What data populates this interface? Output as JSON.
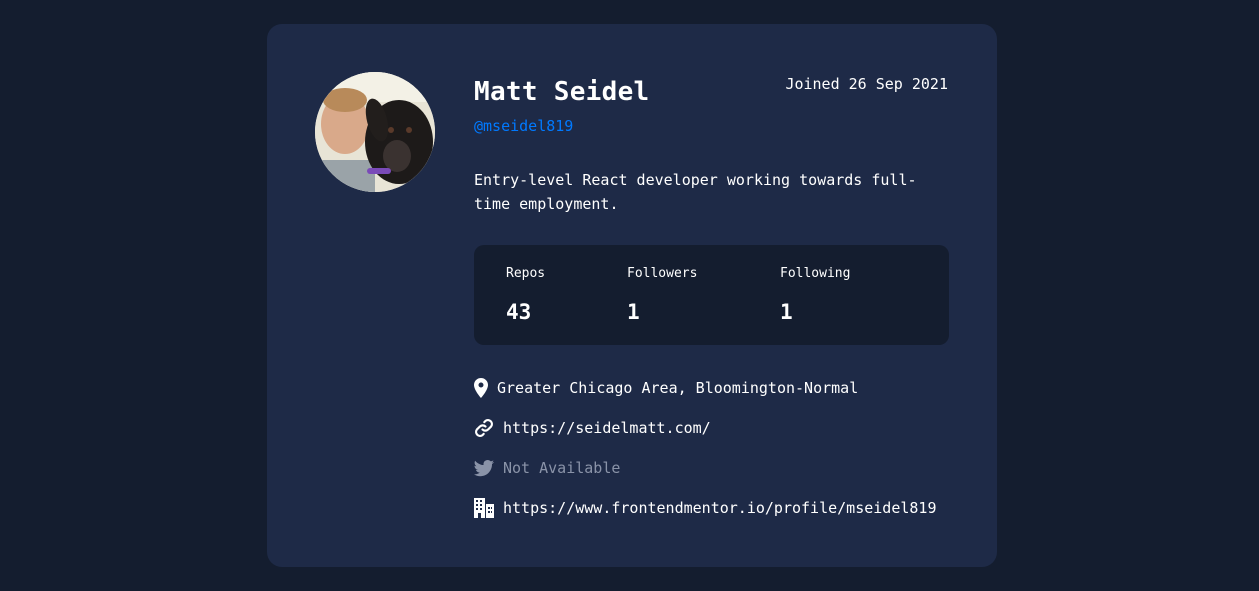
{
  "profile": {
    "name": "Matt Seidel",
    "handle": "@mseidel819",
    "joined": "Joined 26 Sep 2021",
    "bio": "Entry-level React developer working towards full-time employment."
  },
  "stats": {
    "repos": {
      "label": "Repos",
      "value": "43"
    },
    "followers": {
      "label": "Followers",
      "value": "1"
    },
    "following": {
      "label": "Following",
      "value": "1"
    }
  },
  "links": {
    "location": {
      "icon": "location-pin-icon",
      "text": "Greater Chicago Area, Bloomington-Normal"
    },
    "website": {
      "icon": "link-icon",
      "text": "https://seidelmatt.com/"
    },
    "twitter": {
      "icon": "twitter-icon",
      "text": "Not Available",
      "available": false
    },
    "company": {
      "icon": "company-building-icon",
      "text": "https://www.frontendmentor.io/profile/mseidel819"
    }
  },
  "colors": {
    "page_background": "#141d2f",
    "card_background": "#1e2a47",
    "accent": "#0079ff",
    "muted": "#8a93a8"
  }
}
